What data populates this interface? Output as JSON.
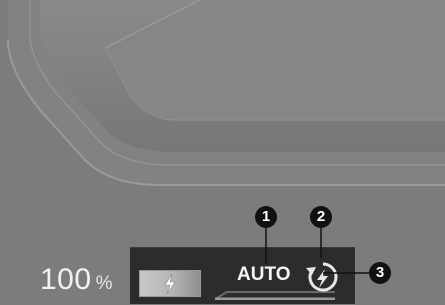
{
  "battery": {
    "percent_value": "100",
    "percent_unit": "%"
  },
  "status_bar": {
    "charge_icon": "lightning-bolt-icon",
    "mode_label": "AUTO",
    "regen_icon": "circular-arrow-lightning-icon"
  },
  "callouts": {
    "one": "1",
    "two": "2",
    "three": "3"
  },
  "colors": {
    "background": "#7c7c7c",
    "status_bar": "#2c2c2c",
    "callout": "#111111",
    "text": "#f2f2f2"
  }
}
